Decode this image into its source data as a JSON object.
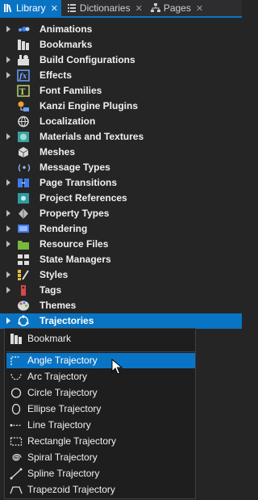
{
  "tabs": [
    {
      "label": "Library",
      "close": "✕",
      "icon": "library-icon",
      "active": true
    },
    {
      "label": "Dictionaries",
      "close": "✕",
      "icon": "dictionaries-icon",
      "active": false
    },
    {
      "label": "Pages",
      "close": "✕",
      "icon": "pages-icon",
      "active": false
    }
  ],
  "tree": [
    {
      "label": "Animations",
      "expandable": true,
      "icon": "animations-icon"
    },
    {
      "label": "Bookmarks",
      "expandable": false,
      "icon": "bookmarks-icon"
    },
    {
      "label": "Build Configurations",
      "expandable": true,
      "icon": "build-configurations-icon"
    },
    {
      "label": "Effects",
      "expandable": true,
      "icon": "effects-icon"
    },
    {
      "label": "Font Families",
      "expandable": false,
      "icon": "font-families-icon"
    },
    {
      "label": "Kanzi Engine Plugins",
      "expandable": false,
      "icon": "plugins-icon"
    },
    {
      "label": "Localization",
      "expandable": false,
      "icon": "localization-icon"
    },
    {
      "label": "Materials and Textures",
      "expandable": true,
      "icon": "materials-icon"
    },
    {
      "label": "Meshes",
      "expandable": false,
      "icon": "meshes-icon"
    },
    {
      "label": "Message Types",
      "expandable": false,
      "icon": "message-types-icon"
    },
    {
      "label": "Page Transitions",
      "expandable": true,
      "icon": "page-transitions-icon"
    },
    {
      "label": "Project References",
      "expandable": false,
      "icon": "project-references-icon"
    },
    {
      "label": "Property Types",
      "expandable": true,
      "icon": "property-types-icon"
    },
    {
      "label": "Rendering",
      "expandable": true,
      "icon": "rendering-icon"
    },
    {
      "label": "Resource Files",
      "expandable": true,
      "icon": "resource-files-icon"
    },
    {
      "label": "State Managers",
      "expandable": false,
      "icon": "state-managers-icon"
    },
    {
      "label": "Styles",
      "expandable": true,
      "icon": "styles-icon"
    },
    {
      "label": "Tags",
      "expandable": true,
      "icon": "tags-icon"
    },
    {
      "label": "Themes",
      "expandable": false,
      "icon": "themes-icon"
    },
    {
      "label": "Trajectories",
      "expandable": true,
      "icon": "trajectories-icon",
      "selected": true
    }
  ],
  "menu": {
    "items": [
      {
        "label": "Bookmark",
        "icon": "bookmark-icon"
      },
      {
        "label": "Angle Trajectory",
        "icon": "angle-trajectory-icon",
        "highlighted": true
      },
      {
        "label": "Arc Trajectory",
        "icon": "arc-trajectory-icon"
      },
      {
        "label": "Circle Trajectory",
        "icon": "circle-trajectory-icon"
      },
      {
        "label": "Ellipse Trajectory",
        "icon": "ellipse-trajectory-icon"
      },
      {
        "label": "Line Trajectory",
        "icon": "line-trajectory-icon"
      },
      {
        "label": "Rectangle Trajectory",
        "icon": "rectangle-trajectory-icon"
      },
      {
        "label": "Spiral Trajectory",
        "icon": "spiral-trajectory-icon"
      },
      {
        "label": "Spline Trajectory",
        "icon": "spline-trajectory-icon"
      },
      {
        "label": "Trapezoid Trajectory",
        "icon": "trapezoid-trajectory-icon"
      }
    ]
  },
  "colors": {
    "accent": "#0a74c4",
    "background": "#252526",
    "menu_bg": "#1e1e1e"
  }
}
